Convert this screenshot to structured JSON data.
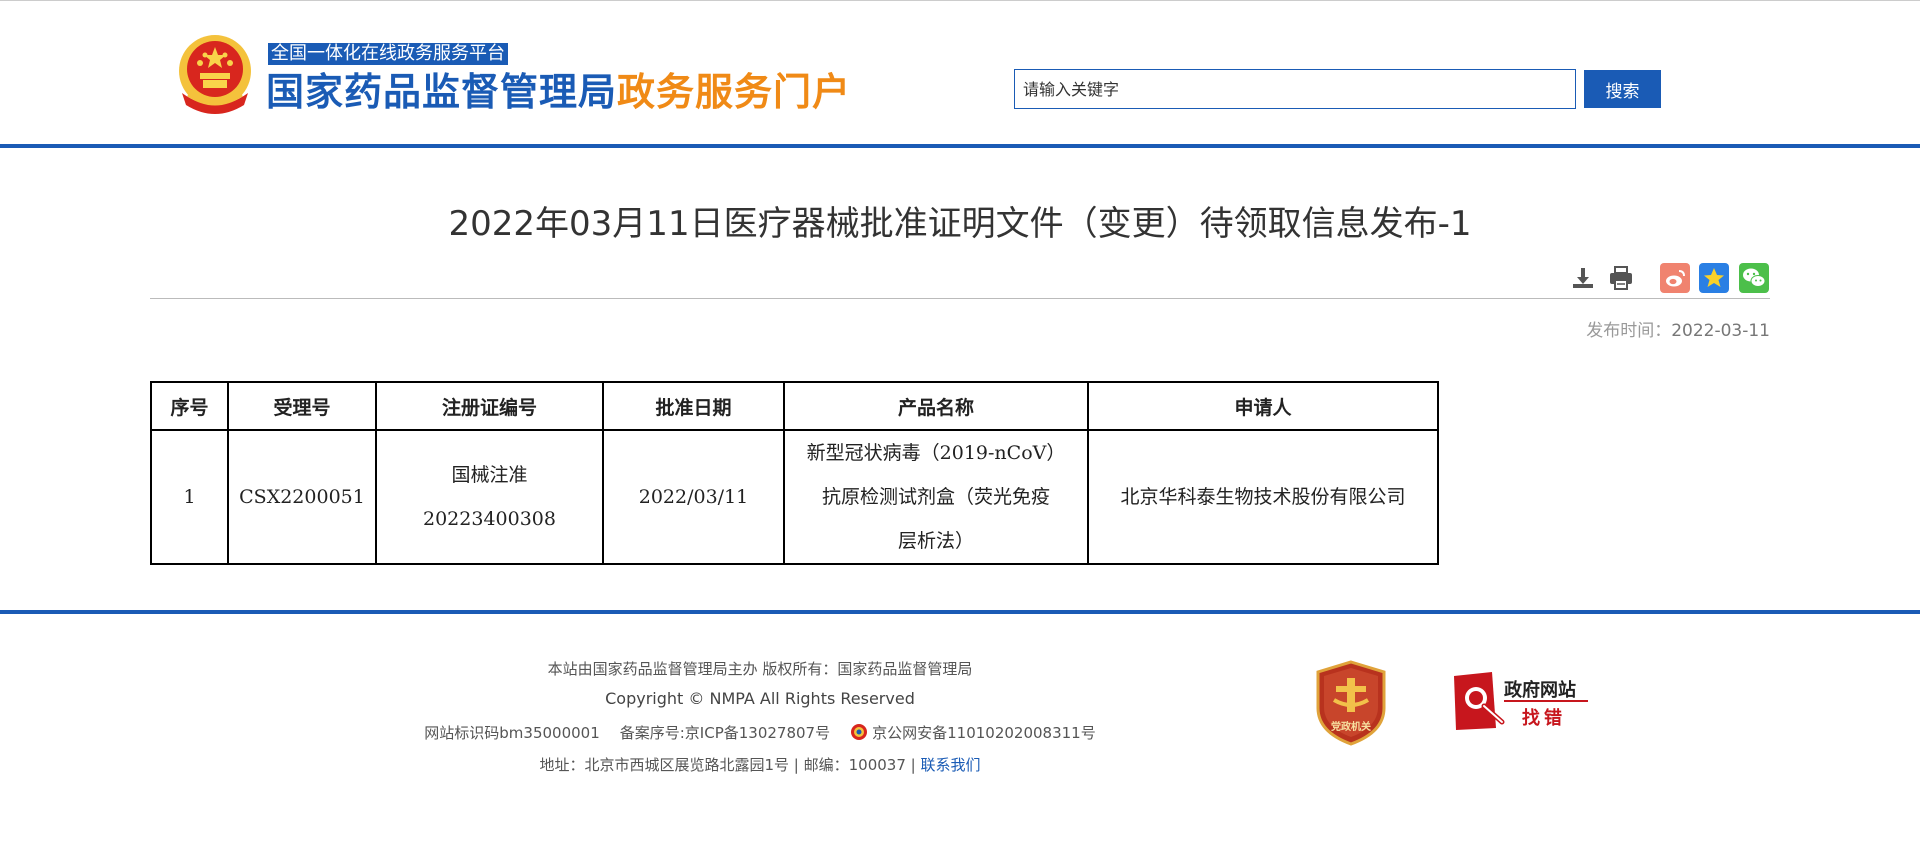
{
  "header": {
    "platform_tag": "全国一体化在线政务服务平台",
    "site_title_blue": "国家药品监督管理局",
    "site_title_orange": "政务服务门户",
    "search": {
      "placeholder": "请输入关键字",
      "button_label": "搜索"
    }
  },
  "article": {
    "title": "2022年03月11日医疗器械批准证明文件（变更）待领取信息发布-1",
    "publish_label": "发布时间：",
    "publish_date": "2022-03-11",
    "share_icons": [
      "download-icon",
      "print-icon",
      "weibo-icon",
      "qzone-icon",
      "wechat-icon"
    ]
  },
  "table": {
    "headers": [
      "序号",
      "受理号",
      "注册证编号",
      "批准日期",
      "产品名称",
      "申请人"
    ],
    "rows": [
      {
        "seq": "1",
        "acceptance_no": "CSX2200051",
        "reg_no_line1": "国械注准",
        "reg_no_line2": "20223400308",
        "approval_date": "2022/03/11",
        "product_line1": "新型冠状病毒（2019-nCoV）",
        "product_line2": "抗原检测试剂盒（荧光免疫",
        "product_line3": "层析法）",
        "applicant": "北京华科泰生物技术股份有限公司"
      }
    ]
  },
  "footer": {
    "line1": "本站由国家药品监督管理局主办 版权所有：国家药品监督管理局",
    "line2": "Copyright © NMPA All Rights Reserved",
    "site_code": "网站标识码bm35000001",
    "icp": "备案序号:京ICP备13027807号",
    "police": "京公网安备11010202008311号",
    "address": "地址：北京市西城区展览路北露园1号 | 邮编：100037 |",
    "contact_link": "联系我们",
    "badge_text": "党政机关",
    "gov_error_line1": "政府网站",
    "gov_error_line2": "找错"
  },
  "colors": {
    "brand_blue": "#1a5bb5",
    "title_orange": "#f08a16",
    "error_red": "#c7161d"
  }
}
